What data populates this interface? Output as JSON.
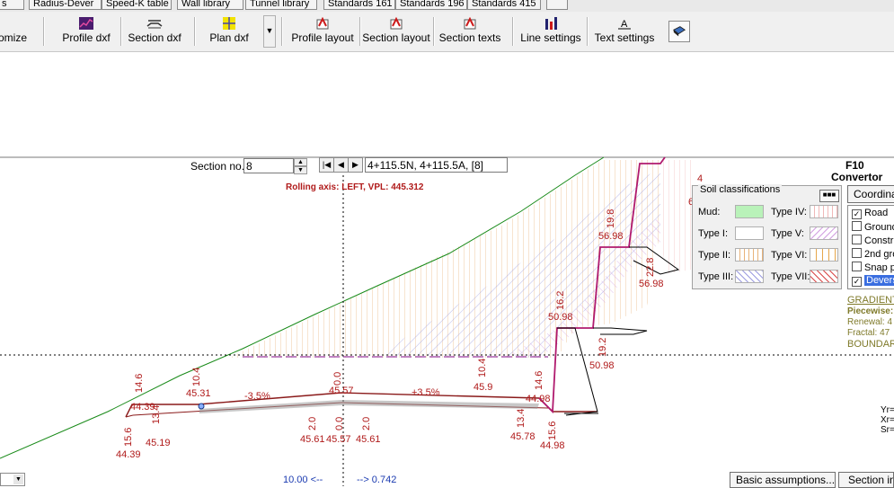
{
  "top_tabs": [
    "s",
    "Radius-Dever",
    "Speed-K table",
    "Wall library",
    "Tunnel library",
    "Standards 161",
    "Standards 196",
    "Standards 415"
  ],
  "toolbar": {
    "buttons": [
      "omize",
      "Profile dxf",
      "Section dxf",
      "Plan dxf",
      "Profile layout",
      "Section layout",
      "Section texts",
      "Line settings",
      "Text settings"
    ],
    "dropdown_arrow": "▼"
  },
  "section": {
    "label": "Section no.:",
    "value": "8",
    "station_text": "4+115.5N, 4+115.5A, [8]"
  },
  "rolling_axis": "Rolling axis:   LEFT,   VPL: 445.312",
  "soil_panel": {
    "title": "Soil classifications",
    "items": [
      {
        "label": "Mud:",
        "color": "#b9f2b9"
      },
      {
        "label": "Type IV:",
        "color": "#fde3dc"
      },
      {
        "label": "Type I:",
        "color": "#ffffff"
      },
      {
        "label": "Type V:",
        "color": "#f3d7f3"
      },
      {
        "label": "Type II:",
        "color": "#fff0dc"
      },
      {
        "label": "Type VI:",
        "color": "#fde8c4"
      },
      {
        "label": "Type III:",
        "color": "#e6e2fb"
      },
      {
        "label": "Type VII:",
        "color": "#f6c8c8"
      }
    ]
  },
  "right_panel": {
    "title_line1": "F10",
    "title_line2": "Convertor",
    "coord_button": "Coordinat",
    "checkboxes": [
      {
        "label": "Road",
        "checked": true
      },
      {
        "label": "Ground",
        "checked": false
      },
      {
        "label": "Constru",
        "checked": false
      },
      {
        "label": "2nd gro",
        "checked": false
      },
      {
        "label": "Snap p",
        "checked": false
      },
      {
        "label": "Devers",
        "checked": true
      }
    ],
    "gradient": "GRADIENT",
    "piecewise": "Piecewise:",
    "renewal": "Renewal: 4",
    "fractal": "Fractal: 47",
    "boundary": "BOUNDAR",
    "yr": "Yr=",
    "xr": "Xr=",
    "sr": "Sr="
  },
  "drawing_labels": {
    "l_4439a": "44.39",
    "l_146a": "14.6",
    "l_134a": "13.4",
    "l_156a": "15.6",
    "l_4439b": "44.39",
    "l_4519": "45.19",
    "l_104a": "10.4",
    "l_4531": "45.31",
    "l_m35": "-3.5%",
    "l_00a": "0.0",
    "l_4557a": "45.57",
    "l_20a": "2.0",
    "l_00b": "0.0",
    "l_20b": "2.0",
    "l_4561a": "45.61",
    "l_4557b": "45.57",
    "l_4561b": "45.61",
    "l_p35": "+3.5%",
    "l_104b": "10.4",
    "l_459": "45.9",
    "l_146b": "14.6",
    "l_4498a": "44.98",
    "l_134b": "13.4",
    "l_156b": "15.6",
    "l_4578": "45.78",
    "l_4498b": "44.98",
    "l_162": "16.2",
    "l_5098a": "50.98",
    "l_192": "19.2",
    "l_5098b": "50.98",
    "l_198": "19.8",
    "l_5698a": "56.98",
    "l_228": "22.8",
    "l_5698b": "56.98",
    "l_4": "4",
    "l_6": "6"
  },
  "bottom": {
    "scale_left": "10.00 <--",
    "scale_right": "--> 0.742",
    "basic_assumptions": "Basic assumptions...",
    "section_info": "Section inf"
  }
}
